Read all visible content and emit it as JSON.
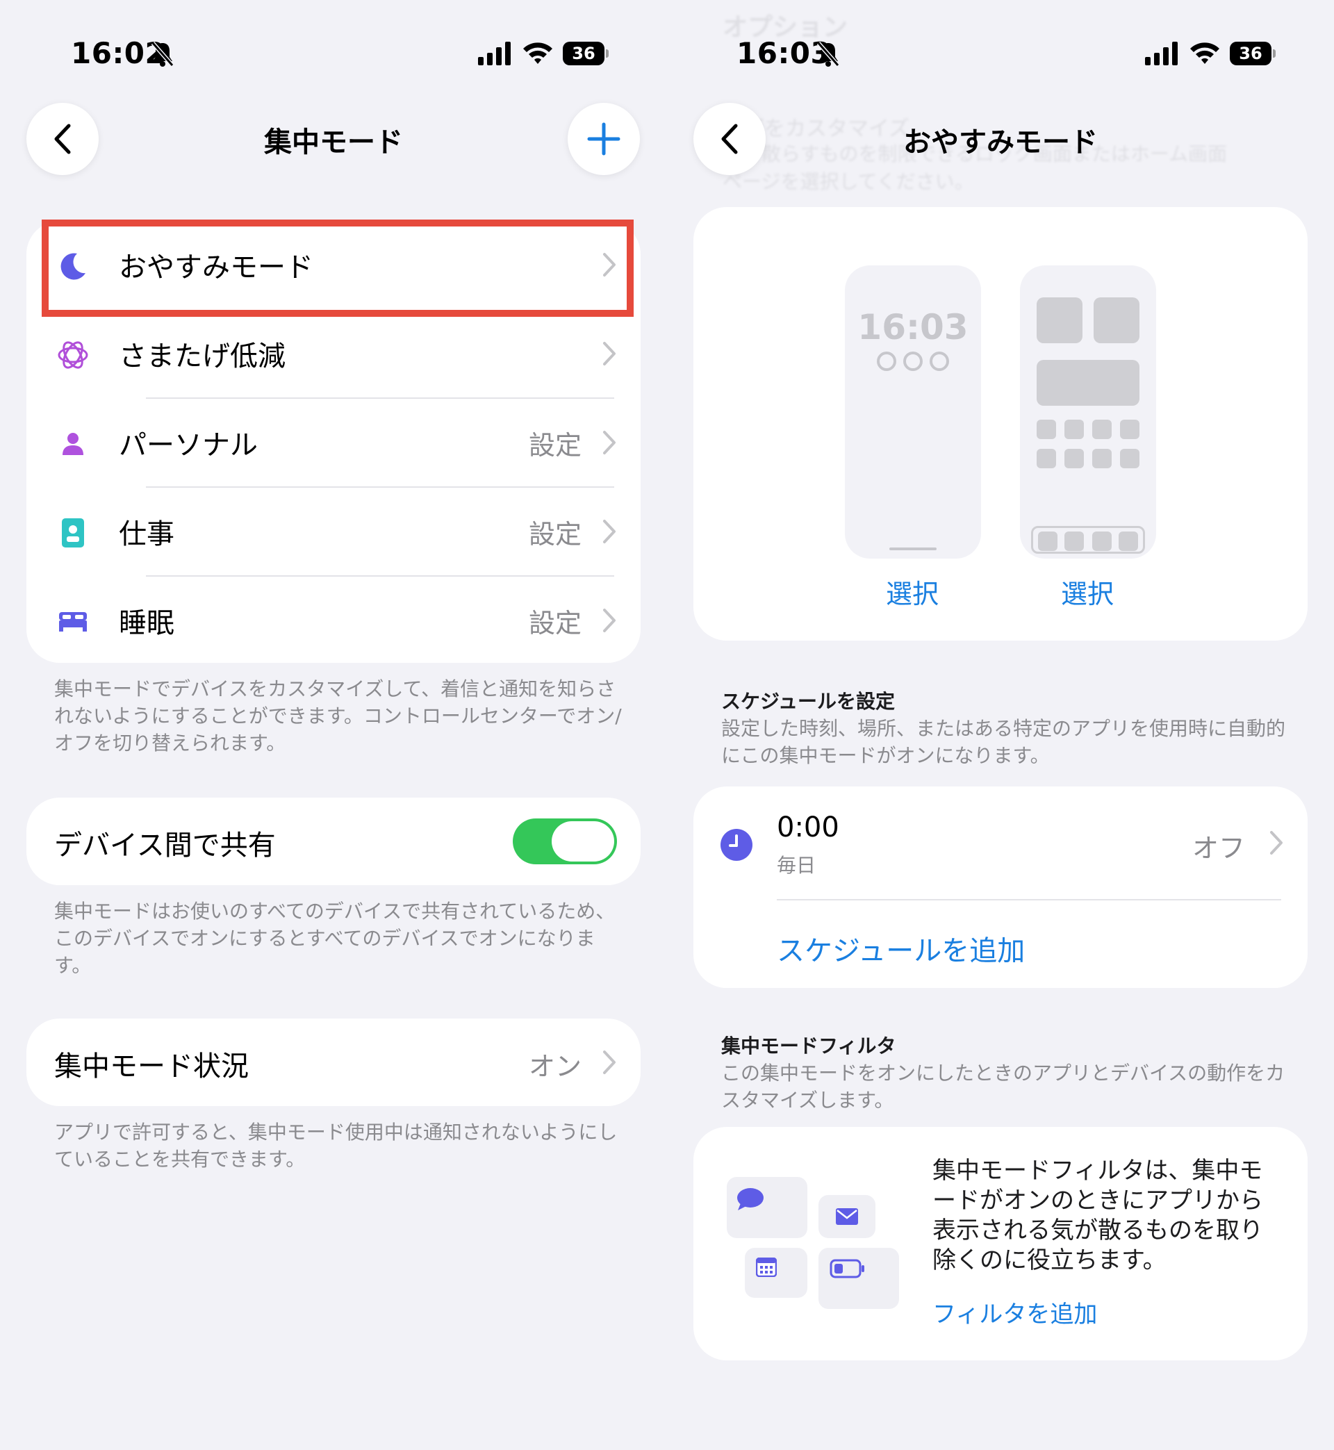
{
  "left": {
    "status": {
      "time": "16:02",
      "battery": "36"
    },
    "nav": {
      "title": "集中モード"
    },
    "focus_modes": [
      {
        "label": "おやすみモード",
        "value": ""
      },
      {
        "label": "さまたげ低減",
        "value": ""
      },
      {
        "label": "パーソナル",
        "value": "設定"
      },
      {
        "label": "仕事",
        "value": "設定"
      },
      {
        "label": "睡眠",
        "value": "設定"
      }
    ],
    "modes_footnote": "集中モードでデバイスをカスタマイズして、着信と通知を知らされないようにすることができます。コントロールセンターでオン/オフを切り替えられます。",
    "share_across": {
      "label": "デバイス間で共有",
      "enabled": true
    },
    "share_footnote": "集中モードはお使いのすべてのデバイスで共有されているため、このデバイスでオンにするとすべてのデバイスでオンになります。",
    "focus_status": {
      "label": "集中モード状況",
      "value": "オン"
    },
    "status_footnote": "アプリで許可すると、集中モード使用中は通知されないようにしていることを共有できます。",
    "colors": {
      "highlight": "#e64a3c",
      "toggle_on": "#34c759",
      "accent": "#1a7fe0"
    }
  },
  "right": {
    "status": {
      "time": "16:03",
      "battery": "36"
    },
    "nav": {
      "title": "おやすみモード"
    },
    "faded": {
      "options": "オプション",
      "customize_header": "画面をカスタマイズ",
      "customize_desc_1": "気を散らすものを制限できるロック画面またはホーム画面",
      "customize_desc_2": "ページを選択してください。"
    },
    "lock_preview": {
      "time": "16:03",
      "select": "選択"
    },
    "home_preview": {
      "select": "選択"
    },
    "schedule": {
      "header": "スケジュールを設定",
      "desc": "設定した時刻、場所、またはある特定のアプリを使用時に自動的にこの集中モードがオンになります。",
      "item_time": "0:00",
      "item_repeat": "毎日",
      "item_state": "オフ",
      "add_label": "スケジュールを追加"
    },
    "filters": {
      "header": "集中モードフィルタ",
      "desc": "この集中モードをオンにしたときのアプリとデバイスの動作をカスタマイズします。",
      "body": "集中モードフィルタは、集中モードがオンのときにアプリから表示される気が散るものを取り除くのに役立ちます。",
      "add_label": "フィルタを追加"
    }
  }
}
